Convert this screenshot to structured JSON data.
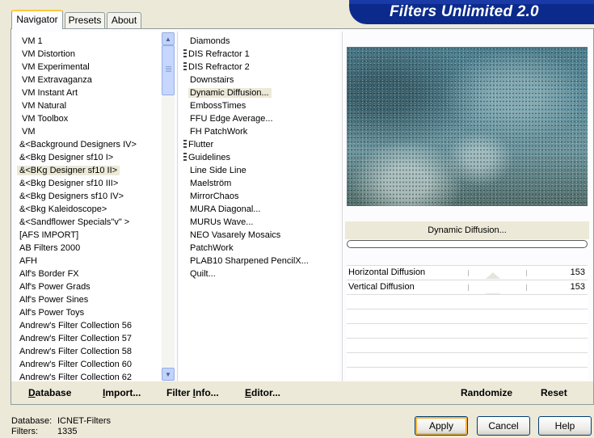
{
  "app": {
    "title": "Filters Unlimited 2.0"
  },
  "tabs": [
    {
      "label": "Navigator",
      "active": true
    },
    {
      "label": "Presets",
      "active": false
    },
    {
      "label": "About",
      "active": false
    }
  ],
  "categories": {
    "items": [
      "VM 1",
      "VM Distortion",
      "VM Experimental",
      "VM Extravaganza",
      "VM Instant Art",
      "VM Natural",
      "VM Toolbox",
      "VM",
      "&<Background Designers IV>",
      "&<Bkg Designer sf10 I>",
      "&<BKg Designer sf10 II>",
      "&<Bkg Designer sf10 III>",
      "&<Bkg Designers sf10 IV>",
      "&<Bkg Kaleidoscope>",
      "&<Sandflower Specials\"v\" >",
      "[AFS IMPORT]",
      "AB Filters 2000",
      "AFH",
      "Alf's Border FX",
      "Alf's Power Grads",
      "Alf's Power Sines",
      "Alf's Power Toys",
      "Andrew's Filter Collection 56",
      "Andrew's Filter Collection 57",
      "Andrew's Filter Collection 58",
      "Andrew's Filter Collection 60",
      "Andrew's Filter Collection 62"
    ],
    "selected": "&<BKg Designer sf10 II>"
  },
  "filters": {
    "items": [
      {
        "label": "Diamonds",
        "grip": false
      },
      {
        "label": "DIS Refractor 1",
        "grip": true
      },
      {
        "label": "DIS Refractor 2",
        "grip": true
      },
      {
        "label": "Downstairs",
        "grip": false
      },
      {
        "label": "Dynamic Diffusion...",
        "grip": false,
        "selected": true
      },
      {
        "label": "EmbossTimes",
        "grip": false
      },
      {
        "label": "FFU Edge Average...",
        "grip": false
      },
      {
        "label": "FH PatchWork",
        "grip": false
      },
      {
        "label": "Flutter",
        "grip": true
      },
      {
        "label": "Guidelines",
        "grip": true
      },
      {
        "label": "Line Side Line",
        "grip": false
      },
      {
        "label": "Maelström",
        "grip": false
      },
      {
        "label": "MirrorChaos",
        "grip": false
      },
      {
        "label": "MURA Diagonal...",
        "grip": false
      },
      {
        "label": "MURUs Wave...",
        "grip": false
      },
      {
        "label": "NEO Vasarely Mosaics",
        "grip": false
      },
      {
        "label": "PatchWork",
        "grip": false
      },
      {
        "label": "PLAB10 Sharpened PencilX...",
        "grip": false
      },
      {
        "label": "Quilt...",
        "grip": false
      }
    ]
  },
  "preview": {
    "filter_name": "Dynamic Diffusion..."
  },
  "parameters": [
    {
      "label": "Horizontal Diffusion",
      "value": "153",
      "fraction": 0.6
    },
    {
      "label": "Vertical Diffusion",
      "value": "153",
      "fraction": 0.6
    }
  ],
  "actions": {
    "database": {
      "pre": "",
      "u": "D",
      "post": "atabase"
    },
    "import": {
      "pre": "",
      "u": "I",
      "post": "mport..."
    },
    "filter_info": {
      "pre": "Filter ",
      "u": "I",
      "post": "nfo..."
    },
    "editor": {
      "pre": "",
      "u": "E",
      "post": "ditor..."
    },
    "randomize": "Randomize",
    "reset": "Reset"
  },
  "footer": {
    "database_label": "Database:",
    "database_value": "ICNET-Filters",
    "filters_label": "Filters:",
    "filters_value": "1335"
  },
  "buttons": {
    "apply": "Apply",
    "cancel": "Cancel",
    "help": "Help"
  },
  "colors": {
    "banner": "#0b2a8c",
    "tab_highlight": "#ffc83c",
    "button_border": "#003c74"
  }
}
